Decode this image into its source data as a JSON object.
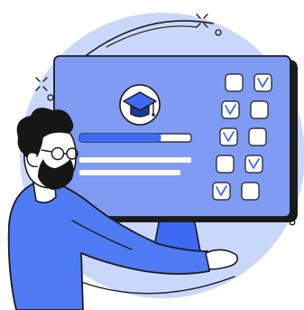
{
  "illustration": {
    "subject": "online-education",
    "icons": [
      "graduation-cap-icon",
      "checkmark-icon"
    ],
    "checklist": {
      "rows": [
        {
          "left_checked": false,
          "right_checked": true
        },
        {
          "left_checked": true,
          "right_checked": false
        },
        {
          "left_checked": true,
          "right_checked": false
        },
        {
          "left_checked": false,
          "right_checked": true
        },
        {
          "left_checked": true,
          "right_checked": false
        }
      ]
    },
    "progress": {
      "fill_fraction": 0.73
    },
    "colors": {
      "background_circle": "#c9d7fb",
      "monitor_screen": "#7f9bf3",
      "monitor_frame": "#1b1b1b",
      "accent_blue": "#3e69f2",
      "sweater": "#4f7cf4",
      "skin": "#ffffff",
      "hair": "#161616",
      "white": "#ffffff"
    }
  }
}
